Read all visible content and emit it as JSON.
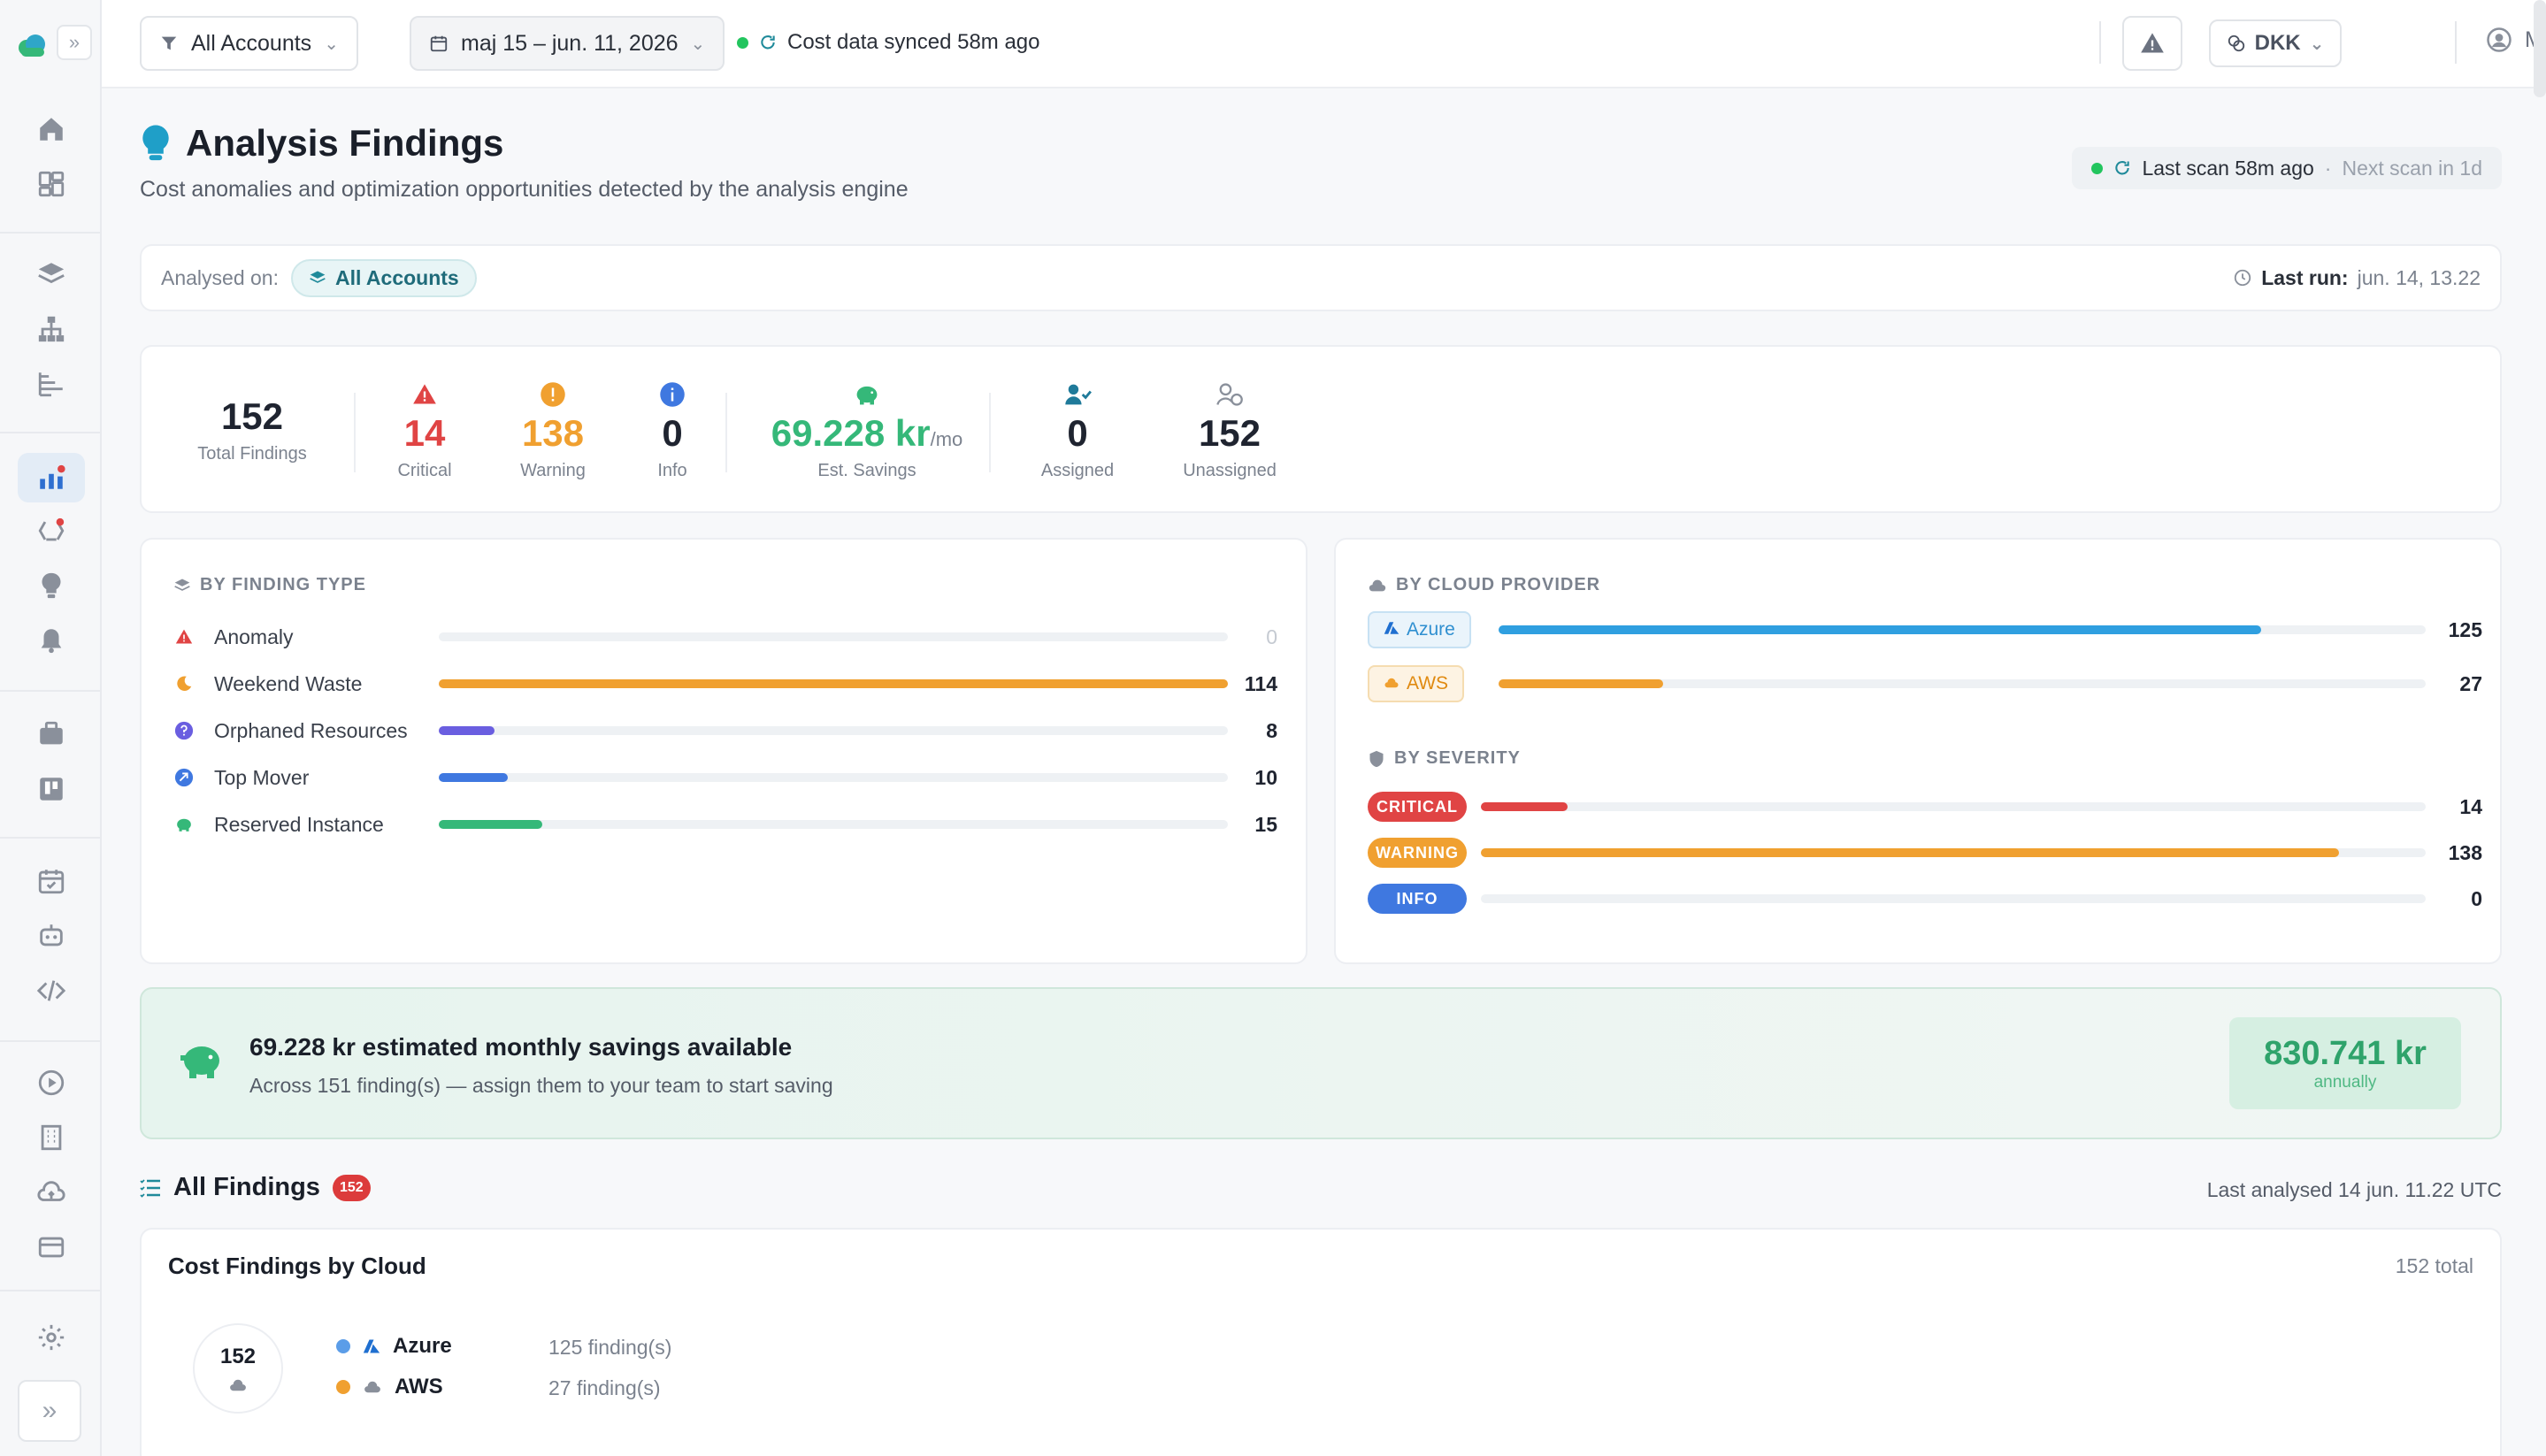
{
  "topbar": {
    "accounts_label": "All Accounts",
    "date_range": "maj 15 – jun. 11, 2026",
    "sync_status": "Cost data synced 58m ago",
    "currency": "DKK",
    "user": "Marik"
  },
  "header": {
    "title": "Analysis Findings",
    "subtitle": "Cost anomalies and optimization opportunities detected by the analysis engine",
    "last_scan": "Last scan 58m ago",
    "separator": "·",
    "next_scan": "Next scan in 1d"
  },
  "analysed": {
    "label": "Analysed on:",
    "account": "All Accounts",
    "last_run_label": "Last run:",
    "last_run_value": "jun. 14, 13.22"
  },
  "stats": {
    "total": {
      "value": "152",
      "label": "Total Findings"
    },
    "critical": {
      "value": "14",
      "label": "Critical"
    },
    "warning": {
      "value": "138",
      "label": "Warning"
    },
    "info": {
      "value": "0",
      "label": "Info"
    },
    "savings": {
      "value": "69.228 kr",
      "unit": "/mo",
      "label": "Est. Savings"
    },
    "assigned": {
      "value": "0",
      "label": "Assigned"
    },
    "unassigned": {
      "value": "152",
      "label": "Unassigned"
    }
  },
  "by_type": {
    "title": "BY FINDING TYPE",
    "max": 114,
    "items": [
      {
        "label": "Anomaly",
        "value": 0,
        "color": "#e5e7eb",
        "icon": "alert-triangle-icon"
      },
      {
        "label": "Weekend Waste",
        "value": 114,
        "color": "#f0a030",
        "icon": "moon-icon"
      },
      {
        "label": "Orphaned Resources",
        "value": 8,
        "color": "#6a5ee0",
        "icon": "question-icon"
      },
      {
        "label": "Top Mover",
        "value": 10,
        "color": "#3f78e0",
        "icon": "trend-up-icon"
      },
      {
        "label": "Reserved Instance",
        "value": 15,
        "color": "#35b879",
        "icon": "piggy-bank-icon"
      }
    ]
  },
  "by_provider": {
    "title": "BY CLOUD PROVIDER",
    "max": 152,
    "items": [
      {
        "label": "Azure",
        "value": 125,
        "color": "#2f9fe0"
      },
      {
        "label": "AWS",
        "value": 27,
        "color": "#f0a030"
      }
    ]
  },
  "by_severity": {
    "title": "BY SEVERITY",
    "max": 152,
    "items": [
      {
        "label": "CRITICAL",
        "value": 14,
        "color": "#e04444"
      },
      {
        "label": "WARNING",
        "value": 138,
        "color": "#f0a030"
      },
      {
        "label": "INFO",
        "value": 0,
        "color": "#3f78e0"
      }
    ]
  },
  "savings_banner": {
    "title": "69.228 kr estimated monthly savings available",
    "subtitle": "Across 151 finding(s) — assign them to your team to start saving",
    "annual_value": "830.741 kr",
    "annual_label": "annually"
  },
  "all_findings": {
    "title": "All Findings",
    "count": "152",
    "last_analysed": "Last analysed 14 jun. 11.22 UTC"
  },
  "cost_by_cloud": {
    "title": "Cost Findings by Cloud",
    "total": "152 total",
    "center": "152",
    "legend": [
      {
        "name": "Azure",
        "count": "125 finding(s)",
        "color": "#5b9de8"
      },
      {
        "name": "AWS",
        "count": "27 finding(s)",
        "color": "#f0a030"
      }
    ]
  }
}
